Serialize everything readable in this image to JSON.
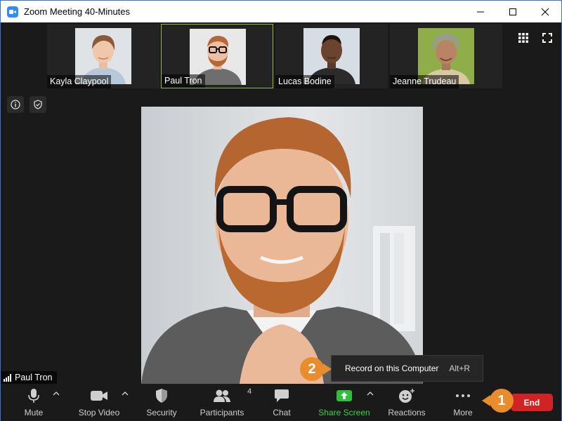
{
  "window": {
    "title": "Zoom Meeting 40-Minutes"
  },
  "participants": [
    {
      "name": "Kayla Claypool"
    },
    {
      "name": "Paul Tron"
    },
    {
      "name": "Lucas Bodine"
    },
    {
      "name": "Jeanne Trudeau"
    }
  ],
  "main_video": {
    "name": "Paul Tron"
  },
  "menu": {
    "item_label": "Record on this Computer",
    "item_shortcut": "Alt+R"
  },
  "callouts": {
    "first": "1",
    "second": "2"
  },
  "toolbar": {
    "mute": "Mute",
    "stop_video": "Stop Video",
    "security": "Security",
    "participants": "Participants",
    "participants_count": "4",
    "chat": "Chat",
    "share_screen": "Share Screen",
    "reactions": "Reactions",
    "more": "More",
    "end": "End"
  },
  "colors": {
    "accent": "#2d8cff",
    "share_green": "#3fd04a",
    "end_red": "#d12323",
    "callout_orange": "#e98c2c",
    "active_border": "#8fbc3b"
  }
}
